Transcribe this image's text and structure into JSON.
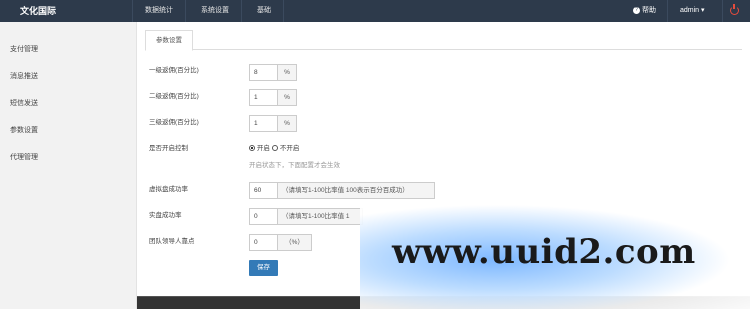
{
  "brand": "文化国际",
  "nav": [
    "数据统计",
    "系统设置",
    "基础"
  ],
  "header_right": {
    "help": "帮助",
    "user": "admin ▾",
    "help_icon": "question-circle-icon",
    "power_icon": "power-icon"
  },
  "sidebar": {
    "items": [
      "支付管理",
      "消息推送",
      "短信发送",
      "参数设置",
      "代理管理"
    ]
  },
  "tab": "参数设置",
  "form": {
    "level1": {
      "label": "一级返佣(百分比)",
      "value": "8",
      "unit": "%"
    },
    "level2": {
      "label": "二级返佣(百分比)",
      "value": "1",
      "unit": "%"
    },
    "level3": {
      "label": "三级返佣(百分比)",
      "value": "1",
      "unit": "%"
    },
    "control": {
      "label": "是否开启控制",
      "option_on": "开启",
      "option_off": "不开启",
      "selected": "开启",
      "hint": "开启状态下，下面配置才会生效"
    },
    "virtual_rate": {
      "label": "虚拟盘成功率",
      "value": "60",
      "hint": "（请填写1-100比率值 100表示百分百成功）"
    },
    "real_rate": {
      "label": "实盘成功率",
      "value": "0",
      "hint": "（请填写1-100比率值 1"
    },
    "team_people": {
      "label": "团队领导人靠点",
      "value": "0",
      "unit": "（%）"
    },
    "save_label": "保存"
  },
  "watermark": "www.uuid2.com",
  "colors": {
    "topbar": "#2d3a4b",
    "primary_button": "#337ab7",
    "power_icon": "#e74c3c"
  }
}
